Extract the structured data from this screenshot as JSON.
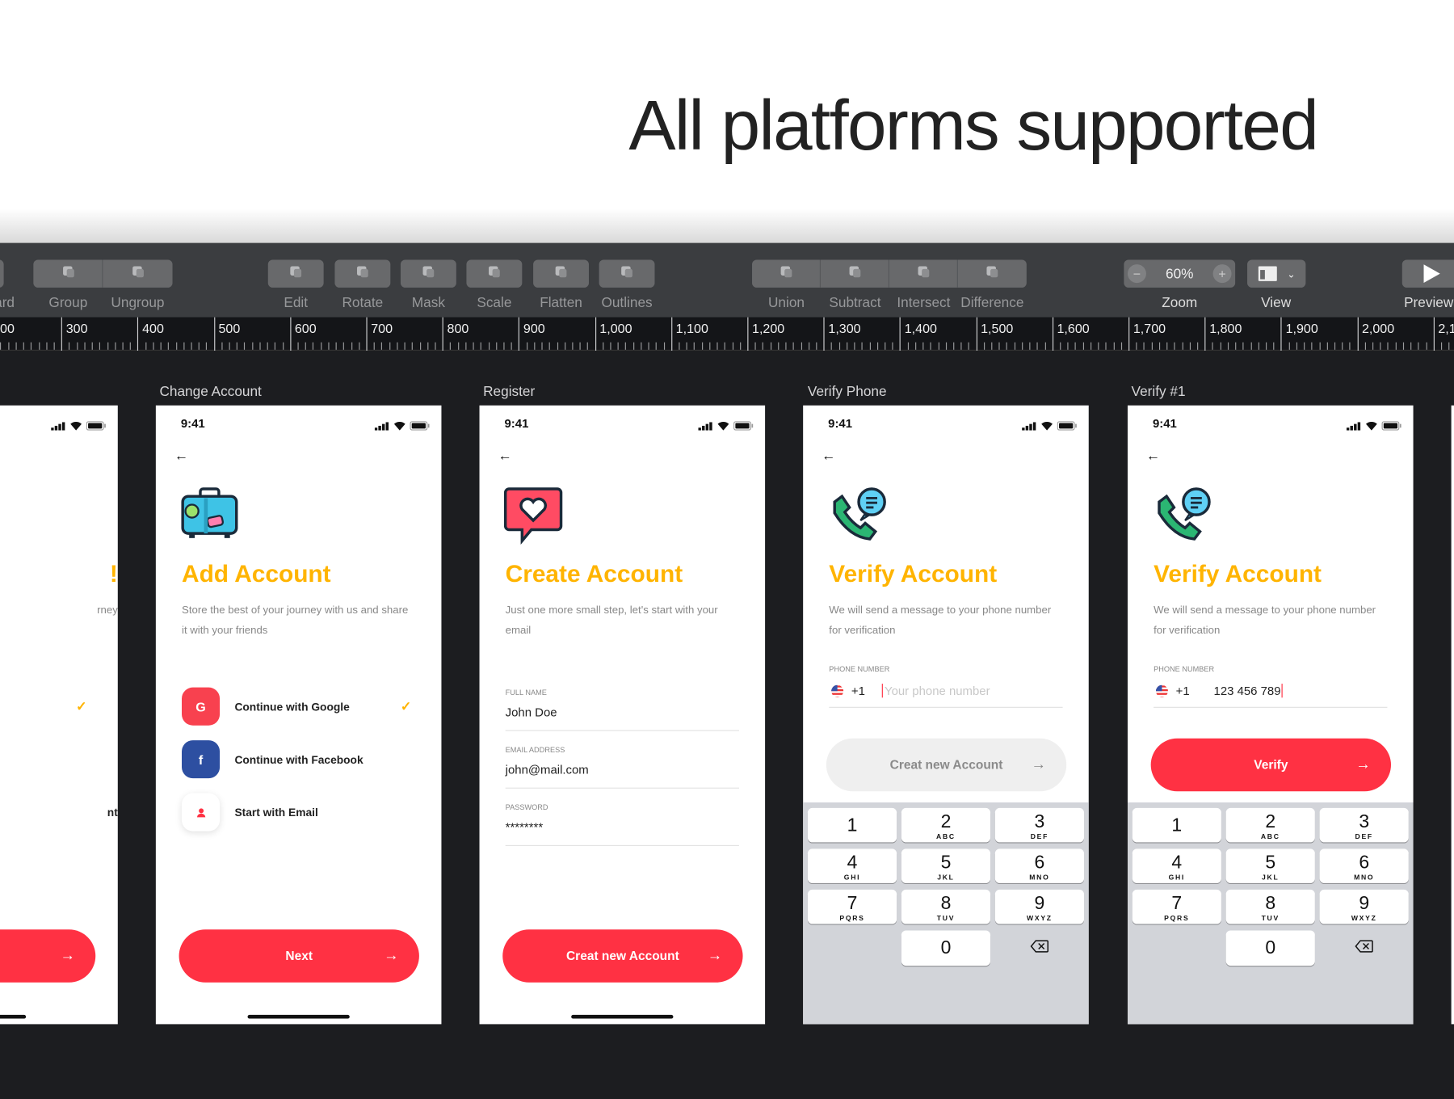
{
  "headline": "All platforms supported",
  "toolbar": {
    "items": [
      {
        "label": "ard",
        "icon": "board-icon"
      },
      {
        "label": "Group",
        "icon": "group-icon"
      },
      {
        "label": "Ungroup",
        "icon": "ungroup-icon"
      },
      {
        "label": "Edit",
        "icon": "edit-path-icon"
      },
      {
        "label": "Rotate",
        "icon": "rotate-icon"
      },
      {
        "label": "Mask",
        "icon": "mask-icon"
      },
      {
        "label": "Scale",
        "icon": "scale-icon"
      },
      {
        "label": "Flatten",
        "icon": "flatten-icon"
      },
      {
        "label": "Outlines",
        "icon": "outlines-icon"
      },
      {
        "label": "Union",
        "icon": "union-icon"
      },
      {
        "label": "Subtract",
        "icon": "subtract-icon"
      },
      {
        "label": "Intersect",
        "icon": "intersect-icon"
      },
      {
        "label": "Difference",
        "icon": "difference-icon"
      }
    ],
    "zoom": {
      "label": "Zoom",
      "value": "60%",
      "minus": "−",
      "plus": "+"
    },
    "view": {
      "label": "View"
    },
    "preview": {
      "label": "Preview"
    }
  },
  "ruler": [
    "00",
    "300",
    "400",
    "500",
    "600",
    "700",
    "800",
    "900",
    "1,000",
    "1,100",
    "1,200",
    "1,300",
    "1,400",
    "1,500",
    "1,600",
    "1,700",
    "1,800",
    "1,900",
    "2,000",
    "2,1"
  ],
  "status_time": "9:41",
  "artboards": {
    "partial": {
      "title_end": "!",
      "sub_end": "rney",
      "row_end": "nt",
      "check": "✓",
      "arrow": "→"
    },
    "change": {
      "label": "Change Account",
      "title": "Add Account",
      "subtitle": "Store the best of your journey with us and share it with your friends",
      "options": [
        {
          "icon": "G",
          "label": "Continue with Google",
          "color": "#f8414f"
        },
        {
          "icon": "f",
          "label": "Continue with Facebook",
          "color": "#2d4fa1"
        },
        {
          "icon": "user",
          "label": "Start with Email",
          "color": "#ffffff"
        }
      ],
      "check": "✓",
      "button": "Next",
      "arrow": "→"
    },
    "register": {
      "label": "Register",
      "title": "Create Account",
      "subtitle": "Just one more small step, let's start with your email",
      "fields": [
        {
          "label": "Full name",
          "value": "John Doe"
        },
        {
          "label": "Email address",
          "value": "john@mail.com"
        },
        {
          "label": "Password",
          "value": "********"
        }
      ],
      "button": "Creat new Account",
      "arrow": "→"
    },
    "verify_phone": {
      "label": "Verify Phone",
      "title": "Verify Account",
      "subtitle": "We will send a message to your phone number for verification",
      "field_label": "Phone number",
      "code": "+1",
      "placeholder": "Your phone number",
      "button": "Creat new Account",
      "arrow": "→"
    },
    "verify1": {
      "label": "Verify #1",
      "title": "Verify Account",
      "subtitle": "We will send a message to your phone number for verification",
      "field_label": "Phone number",
      "code": "+1",
      "value": "123 456 789",
      "button": "Verify",
      "arrow": "→"
    }
  },
  "keypad": [
    {
      "n": "1",
      "l": ""
    },
    {
      "n": "2",
      "l": "ABC"
    },
    {
      "n": "3",
      "l": "DEF"
    },
    {
      "n": "4",
      "l": "GHI"
    },
    {
      "n": "5",
      "l": "JKL"
    },
    {
      "n": "6",
      "l": "MNO"
    },
    {
      "n": "7",
      "l": "PQRS"
    },
    {
      "n": "8",
      "l": "TUV"
    },
    {
      "n": "9",
      "l": "WXYZ"
    },
    {
      "n": "0",
      "l": ""
    }
  ],
  "colors": {
    "accent": "#ffb400",
    "primary": "#ff3143",
    "toolbar": "#3b3d40",
    "canvas": "#1c1d20"
  }
}
